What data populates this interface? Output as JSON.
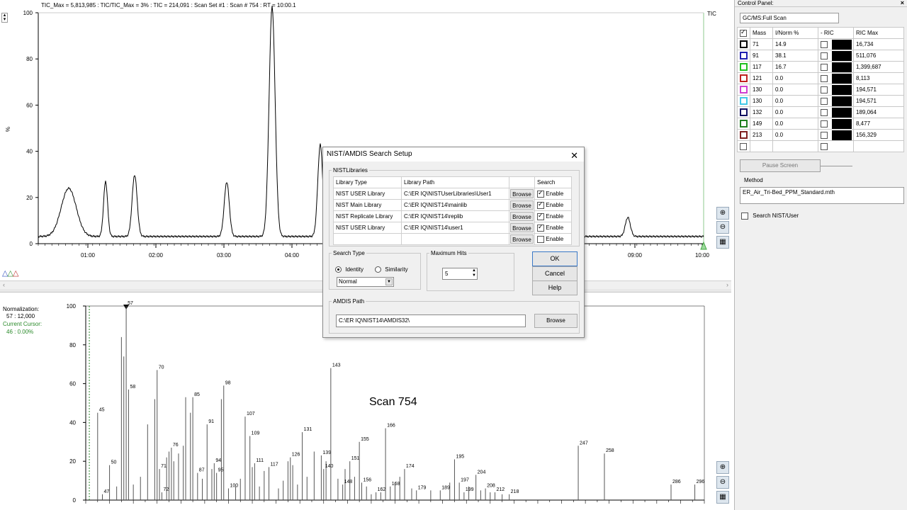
{
  "tic": {
    "header": "TIC_Max = 5,813,985 : TIC/TIC_Max = 3% : TIC = 214,091 : Scan Set #1 : Scan #   754 : RT = 10:00.1",
    "corner_label": "TIC",
    "ylabel": "%",
    "yticks": [
      "100",
      "80",
      "60",
      "40",
      "20",
      "0"
    ],
    "xticks": [
      "01:00",
      "02:00",
      "03:00",
      "04:00",
      "09:00",
      "10:00"
    ]
  },
  "spectrum": {
    "normalization_label": "Normalization:",
    "normalization_value": "57 : 12,000",
    "cursor_label": "Current Cursor:",
    "cursor_value": "46 : 0.00%",
    "scan_title": "Scan 754",
    "yticks": [
      "100",
      "80",
      "60",
      "40",
      "20",
      "0"
    ],
    "peak_labels": [
      {
        "m": "47",
        "v": 3
      },
      {
        "m": "45",
        "v": 45
      },
      {
        "m": "50",
        "v": 18
      },
      {
        "m": "57",
        "v": 100
      },
      {
        "m": "58",
        "v": 57
      },
      {
        "m": "70",
        "v": 67
      },
      {
        "m": "71",
        "v": 16
      },
      {
        "m": "72",
        "v": 4
      },
      {
        "m": "76",
        "v": 27
      },
      {
        "m": "85",
        "v": 53
      },
      {
        "m": "87",
        "v": 14
      },
      {
        "m": "91",
        "v": 39
      },
      {
        "m": "94",
        "v": 19
      },
      {
        "m": "95",
        "v": 14
      },
      {
        "m": "98",
        "v": 59
      },
      {
        "m": "100",
        "v": 6
      },
      {
        "m": "107",
        "v": 43
      },
      {
        "m": "109",
        "v": 33
      },
      {
        "m": "111",
        "v": 19
      },
      {
        "m": "117",
        "v": 17
      },
      {
        "m": "126",
        "v": 22
      },
      {
        "m": "131",
        "v": 35
      },
      {
        "m": "139",
        "v": 23
      },
      {
        "m": "140",
        "v": 16
      },
      {
        "m": "143",
        "v": 68
      },
      {
        "m": "148",
        "v": 8
      },
      {
        "m": "151",
        "v": 20
      },
      {
        "m": "155",
        "v": 30
      },
      {
        "m": "156",
        "v": 9
      },
      {
        "m": "162",
        "v": 4
      },
      {
        "m": "166",
        "v": 37
      },
      {
        "m": "168",
        "v": 7
      },
      {
        "m": "174",
        "v": 16
      },
      {
        "m": "179",
        "v": 5
      },
      {
        "m": "189",
        "v": 5
      },
      {
        "m": "195",
        "v": 21
      },
      {
        "m": "197",
        "v": 9
      },
      {
        "m": "199",
        "v": 4
      },
      {
        "m": "204",
        "v": 13
      },
      {
        "m": "208",
        "v": 6
      },
      {
        "m": "212",
        "v": 4
      },
      {
        "m": "218",
        "v": 3
      },
      {
        "m": "247",
        "v": 28
      },
      {
        "m": "258",
        "v": 24
      },
      {
        "m": "286",
        "v": 8
      },
      {
        "m": "296",
        "v": 8
      }
    ]
  },
  "control_panel": {
    "title": "Control Panel:",
    "mode": "GC/MS:Full Scan",
    "headers": {
      "mass": "Mass",
      "inorm": "I/Norm %",
      "ric": "- RIC",
      "ricmax": "RIC Max"
    },
    "rows": [
      {
        "color": "#000000",
        "mass": "71",
        "inorm": "14.9",
        "ricmax": "16,734"
      },
      {
        "color": "#1f1fb0",
        "mass": "91",
        "inorm": "38.1",
        "ricmax": "511,076"
      },
      {
        "color": "#20c020",
        "mass": "117",
        "inorm": "16.7",
        "ricmax": "1,399,687"
      },
      {
        "color": "#c02020",
        "mass": "121",
        "inorm": "0.0",
        "ricmax": "8,113"
      },
      {
        "color": "#d040d0",
        "mass": "130",
        "inorm": "0.0",
        "ricmax": "194,571"
      },
      {
        "color": "#40c8e8",
        "mass": "130",
        "inorm": "0.0",
        "ricmax": "194,571"
      },
      {
        "color": "#101060",
        "mass": "132",
        "inorm": "0.0",
        "ricmax": "189,064"
      },
      {
        "color": "#208020",
        "mass": "149",
        "inorm": "0.0",
        "ricmax": "8,477"
      },
      {
        "color": "#802020",
        "mass": "213",
        "inorm": "0.0",
        "ricmax": "156,329"
      }
    ],
    "pause_label": "Pause Screen",
    "method_label": "Method",
    "method_value": "ER_Air_Tri-Bed_PPM_Standard.mth",
    "search_nist_label": "Search NIST/User"
  },
  "dialog": {
    "title": "NIST/AMDIS Search Setup",
    "libraries_legend": "NISTLibraries",
    "col_type": "Library Type",
    "col_path": "Library Path",
    "col_search": "Search",
    "libraries": [
      {
        "type": "NIST USER Library",
        "path": "C:\\ER IQ\\NISTUserLibraries\\User1",
        "browse": "Browse",
        "enable": "Enable",
        "checked": true
      },
      {
        "type": "NIST Main Library",
        "path": "C:\\ER IQ\\NIST14\\mainlib",
        "browse": "Browse",
        "enable": "Enable",
        "checked": true
      },
      {
        "type": "NIST Replicate Library",
        "path": "C:\\ER IQ\\NIST14\\replib",
        "browse": "Browse",
        "enable": "Enable",
        "checked": true
      },
      {
        "type": "NIST USER Library",
        "path": "C:\\ER IQ\\NIST14\\user1",
        "browse": "Browse",
        "enable": "Enable",
        "checked": true
      },
      {
        "type": "",
        "path": "",
        "browse": "Browse",
        "enable": "Enable",
        "checked": false
      }
    ],
    "search_type_legend": "Search Type",
    "identity": "Identity",
    "similarity": "Similarity",
    "mode_select": "Normal",
    "max_hits_legend": "Maximum Hits",
    "max_hits_value": "5",
    "ok": "OK",
    "cancel": "Cancel",
    "help": "Help",
    "amdis_legend": "AMDIS Path",
    "amdis_path": "C:\\ER IQ\\NIST14\\AMDIS32\\",
    "amdis_browse": "Browse"
  }
}
